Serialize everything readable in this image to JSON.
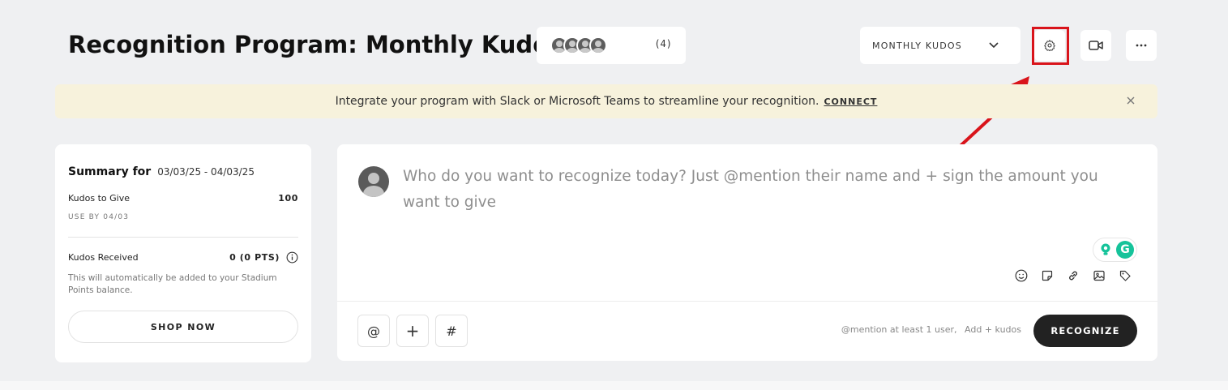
{
  "header": {
    "title": "Recognition Program: Monthly Kudos",
    "member_count": "(4)",
    "program_select_value": "MONTHLY KUDOS"
  },
  "banner": {
    "text": "Integrate your program with Slack or Microsoft Teams to streamline your recognition.",
    "connect_label": "CONNECT"
  },
  "summary": {
    "label": "Summary for",
    "date_range": "03/03/25 - 04/03/25",
    "kudos_to_give_label": "Kudos to Give",
    "kudos_to_give_value": "100",
    "use_by": "USE BY 04/03",
    "kudos_received_label": "Kudos Received",
    "kudos_received_value": "0 (0 PTS)",
    "received_note": "This will automatically be added to your Stadium Points balance.",
    "shop_now_label": "SHOP NOW"
  },
  "composer": {
    "placeholder": "Who do you want to recognize today? Just @mention their name and + sign the amount you want to give",
    "mention_button": "@",
    "plus_button": "+",
    "hash_button": "#",
    "hint_mention": "@mention at least 1 user,",
    "hint_kudos": "Add + kudos",
    "recognize_label": "RECOGNIZE"
  },
  "colors": {
    "highlight": "#d9141b",
    "banner_bg": "#f7f2dc",
    "grammarly": "#15c39a",
    "primary_button": "#222222"
  },
  "icons": [
    "chevron-down-icon",
    "gear-icon",
    "video-camera-icon",
    "more-dots-icon",
    "close-icon",
    "info-icon",
    "emoji-icon",
    "sticker-icon",
    "link-icon",
    "image-icon",
    "tag-icon",
    "grammarly-icon"
  ]
}
